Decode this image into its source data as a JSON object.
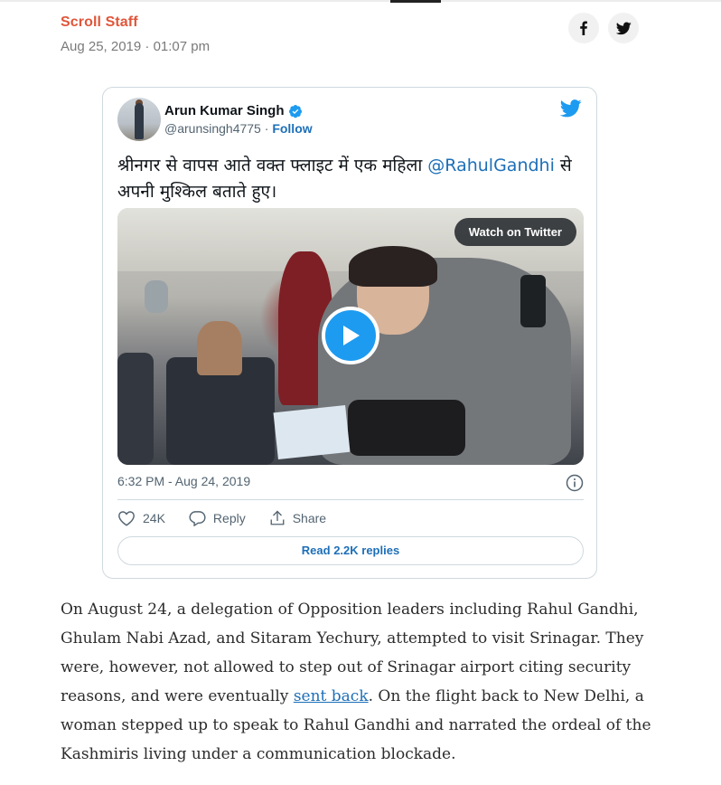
{
  "byline": {
    "author": "Scroll Staff",
    "date": "Aug 25, 2019 · 01:07 pm"
  },
  "share": {
    "facebook_icon": "f",
    "twitter_icon": "twitter-bird"
  },
  "tweet": {
    "display_name": "Arun Kumar Singh",
    "handle": "@arunsingh4775",
    "separator": " · ",
    "follow_label": "Follow",
    "text_before": "श्रीनगर से वापस आते वक्त फ्लाइट में एक महिला ",
    "mention": "@RahulGandhi",
    "text_after": " से अपनी मुश्किल बताते हुए।",
    "watch_label": "Watch on Twitter",
    "timestamp": "6:32 PM - Aug 24, 2019",
    "likes": "24K",
    "reply_label": "Reply",
    "share_label": "Share",
    "read_replies_label": "Read 2.2K replies"
  },
  "article": {
    "text_before_link": "On August 24, a delegation of Opposition leaders including Rahul Gandhi, Ghulam Nabi Azad, and Sitaram Yechury, attempted to visit Srinagar. They were, however, not allowed to step out of Srinagar airport citing security reasons, and were eventually ",
    "link_text": "sent back",
    "text_after_link": ". On the flight back to New Delhi, a woman stepped up to speak to Rahul Gandhi and narrated the ordeal of the Kashmiris living under a communication blockade."
  },
  "colors": {
    "author": "#e0563a",
    "link": "#1d6fb8",
    "twitter_blue": "#1d9bf0",
    "verified": "#1d9bf0"
  }
}
